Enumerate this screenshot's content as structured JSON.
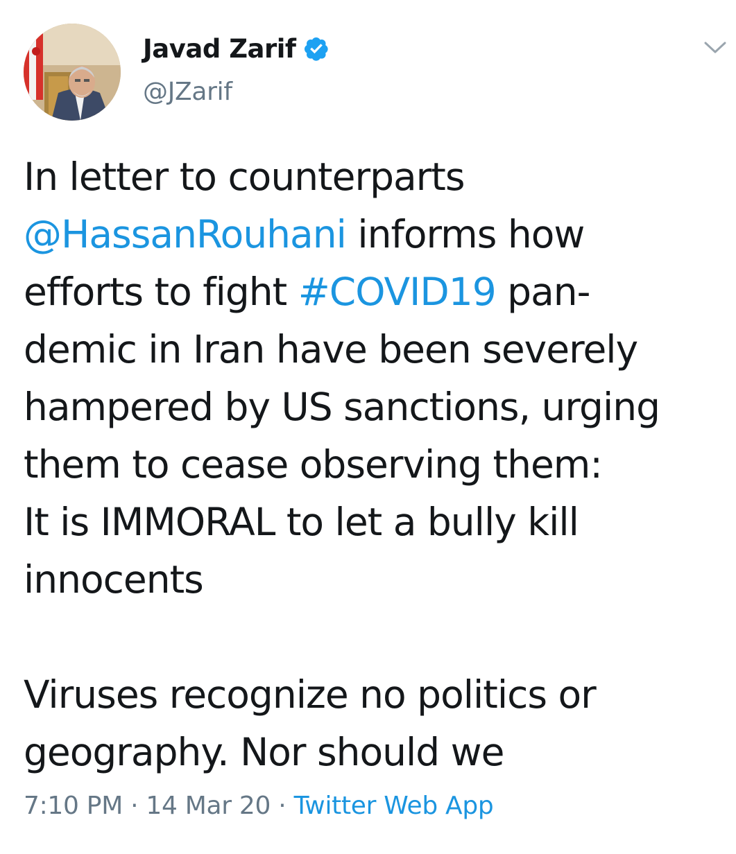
{
  "user": {
    "display_name": "Javad Zarif",
    "handle": "@JZarif",
    "verified": true,
    "avatar_icon": "profile-photo"
  },
  "menu": {
    "icon": "chevron-down-icon"
  },
  "tweet": {
    "lines": [
      [
        {
          "t": "In letter to counterparts",
          "link": false
        }
      ],
      [
        {
          "t": "@HassanRouhani",
          "link": true
        },
        {
          "t": " informs how",
          "link": false
        }
      ],
      [
        {
          "t": "efforts to fight ",
          "link": false
        },
        {
          "t": "#COVID19",
          "link": true
        },
        {
          "t": " pan-",
          "link": false
        }
      ],
      [
        {
          "t": "demic in Iran have been severely",
          "link": false
        }
      ],
      [
        {
          "t": "hampered by US sanctions, urging",
          "link": false
        }
      ],
      [
        {
          "t": "them to cease observing them:",
          "link": false
        }
      ],
      [
        {
          "t": "It is IMMORAL to let a bully kill",
          "link": false
        }
      ],
      [
        {
          "t": "innocents",
          "link": false
        }
      ],
      [],
      [
        {
          "t": "Viruses recognize no politics or",
          "link": false
        }
      ],
      [
        {
          "t": "geography. Nor should we",
          "link": false
        }
      ]
    ]
  },
  "meta": {
    "time": "7:10 PM",
    "separator": " · ",
    "date": "14 Mar 20",
    "source": "Twitter Web App"
  },
  "colors": {
    "link": "#1b95e0",
    "text": "#14171a",
    "secondary": "#657786"
  }
}
